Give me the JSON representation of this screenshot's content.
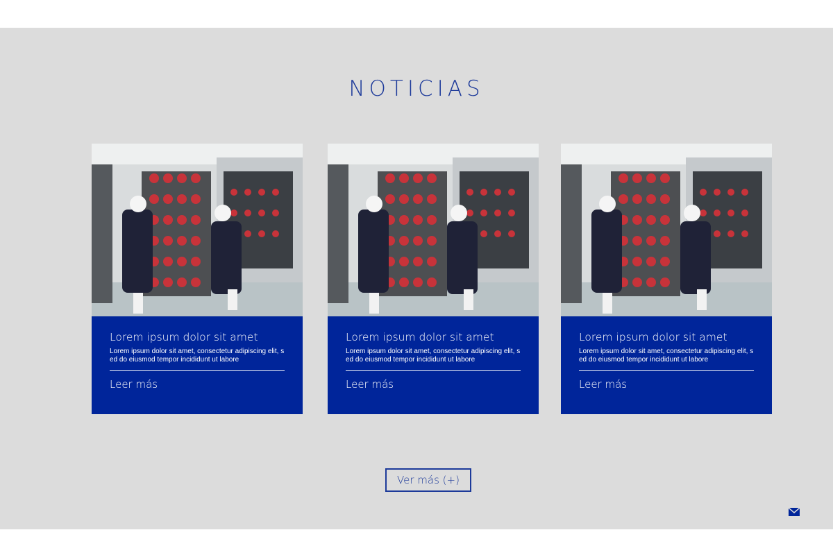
{
  "section": {
    "title": "NOTICIAS"
  },
  "cards": [
    {
      "title": "Lorem ipsum dolor sit amet",
      "text": "Lorem ipsum dolor sit amet, consectetur adipiscing elit, sed do eiusmod tempor incididunt ut labore",
      "link": "Leer más",
      "image": "workers-cold-room-photo"
    },
    {
      "title": "Lorem ipsum dolor sit amet",
      "text": "Lorem ipsum dolor sit amet, consectetur adipiscing elit, sed do eiusmod tempor incididunt ut labore",
      "link": "Leer más",
      "image": "workers-cold-room-photo"
    },
    {
      "title": "Lorem ipsum dolor sit amet",
      "text": "Lorem ipsum dolor sit amet, consectetur adipiscing elit, sed do eiusmod tempor incididunt ut labore",
      "link": "Leer más",
      "image": "workers-cold-room-photo"
    }
  ],
  "more_button": {
    "label": "Ver más (+)"
  },
  "icons": {
    "contact": "mail-icon"
  },
  "colors": {
    "section_bg": "#dcdcdc",
    "accent_blue": "#00259a",
    "title_blue": "#1d3a9a",
    "text_white": "#ffffff"
  }
}
